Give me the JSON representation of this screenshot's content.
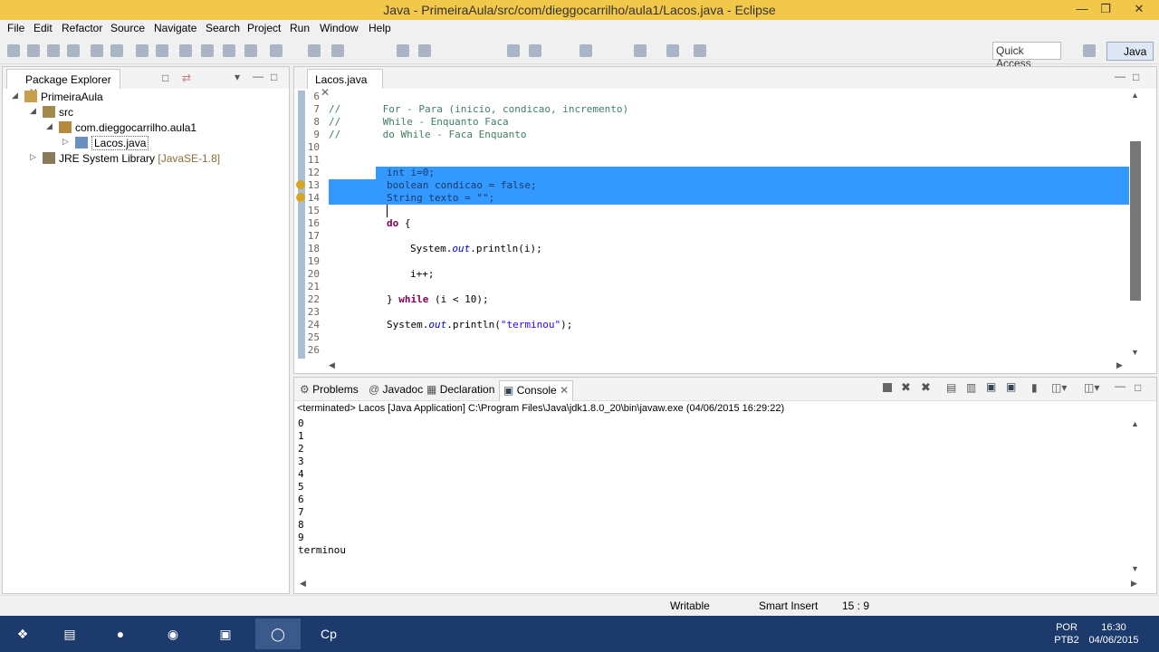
{
  "window": {
    "title": "Java - PrimeiraAula/src/com/dieggocarrilho/aula1/Lacos.java - Eclipse"
  },
  "menu": [
    "File",
    "Edit",
    "Refactor",
    "Source",
    "Navigate",
    "Search",
    "Project",
    "Run",
    "Window",
    "Help"
  ],
  "toolbar": {
    "quick_access": "Quick Access",
    "perspective": "Java"
  },
  "package_explorer": {
    "tab": "Package Explorer",
    "tree": {
      "project": "PrimeiraAula",
      "src": "src",
      "package": "com.dieggocarrilho.aula1",
      "file": "Lacos.java",
      "library": "JRE System Library",
      "library_deco": "[JavaSE-1.8]"
    }
  },
  "editor": {
    "tab": "Lacos.java",
    "lines": [
      {
        "n": "6"
      },
      {
        "n": "7"
      },
      {
        "n": "8"
      },
      {
        "n": "9"
      },
      {
        "n": "10"
      },
      {
        "n": "11"
      },
      {
        "n": "12"
      },
      {
        "n": "13"
      },
      {
        "n": "14"
      },
      {
        "n": "15"
      },
      {
        "n": "16"
      },
      {
        "n": "17"
      },
      {
        "n": "18"
      },
      {
        "n": "19"
      },
      {
        "n": "20"
      },
      {
        "n": "21"
      },
      {
        "n": "22"
      },
      {
        "n": "23"
      },
      {
        "n": "24"
      },
      {
        "n": "25"
      },
      {
        "n": "26"
      }
    ],
    "code": {
      "l7_c": "//",
      "l7_t": "For - Para (inicio, condicao, incremento)",
      "l8_c": "//",
      "l8_t": "While - Enquanto Faca",
      "l9_c": "//",
      "l9_t": "do While - Faca Enquanto",
      "l12": "int i=0;",
      "l13": "boolean condicao = false;",
      "l14_a": "String texto = ",
      "l14_s": "\"\"",
      "l14_b": ";",
      "l16_kw": "do",
      "l16_b": " {",
      "l18_a": "System.",
      "l18_o": "out",
      "l18_b": ".println(i);",
      "l20": "i++;",
      "l22_a": "} ",
      "l22_kw": "while",
      "l22_b": " (i < 10);",
      "l24_a": "System.",
      "l24_o": "out",
      "l24_b": ".println(",
      "l24_s": "\"terminou\"",
      "l24_c": ");"
    }
  },
  "console": {
    "tabs": [
      "Problems",
      "Javadoc",
      "Declaration",
      "Console"
    ],
    "info": "<terminated> Lacos [Java Application] C:\\Program Files\\Java\\jdk1.8.0_20\\bin\\javaw.exe (04/06/2015 16:29:22)",
    "output": [
      "0",
      "1",
      "2",
      "3",
      "4",
      "5",
      "6",
      "7",
      "8",
      "9",
      "terminou"
    ]
  },
  "status": {
    "writable": "Writable",
    "insert": "Smart Insert",
    "position": "15 : 9"
  },
  "taskbar": {
    "lang1": "POR",
    "lang2": "PTB2",
    "time": "16:30",
    "date": "04/06/2015",
    "cp": "Cp"
  }
}
